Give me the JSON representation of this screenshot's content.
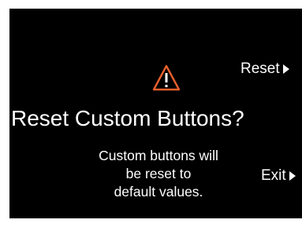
{
  "dialog": {
    "title": "Reset Custom Buttons?",
    "message_lines": [
      "Custom buttons will",
      "be reset to",
      "default values."
    ],
    "icon": "warning-icon",
    "accent_color": "#e8602c"
  },
  "actions": {
    "reset_label": "Reset",
    "exit_label": "Exit"
  }
}
